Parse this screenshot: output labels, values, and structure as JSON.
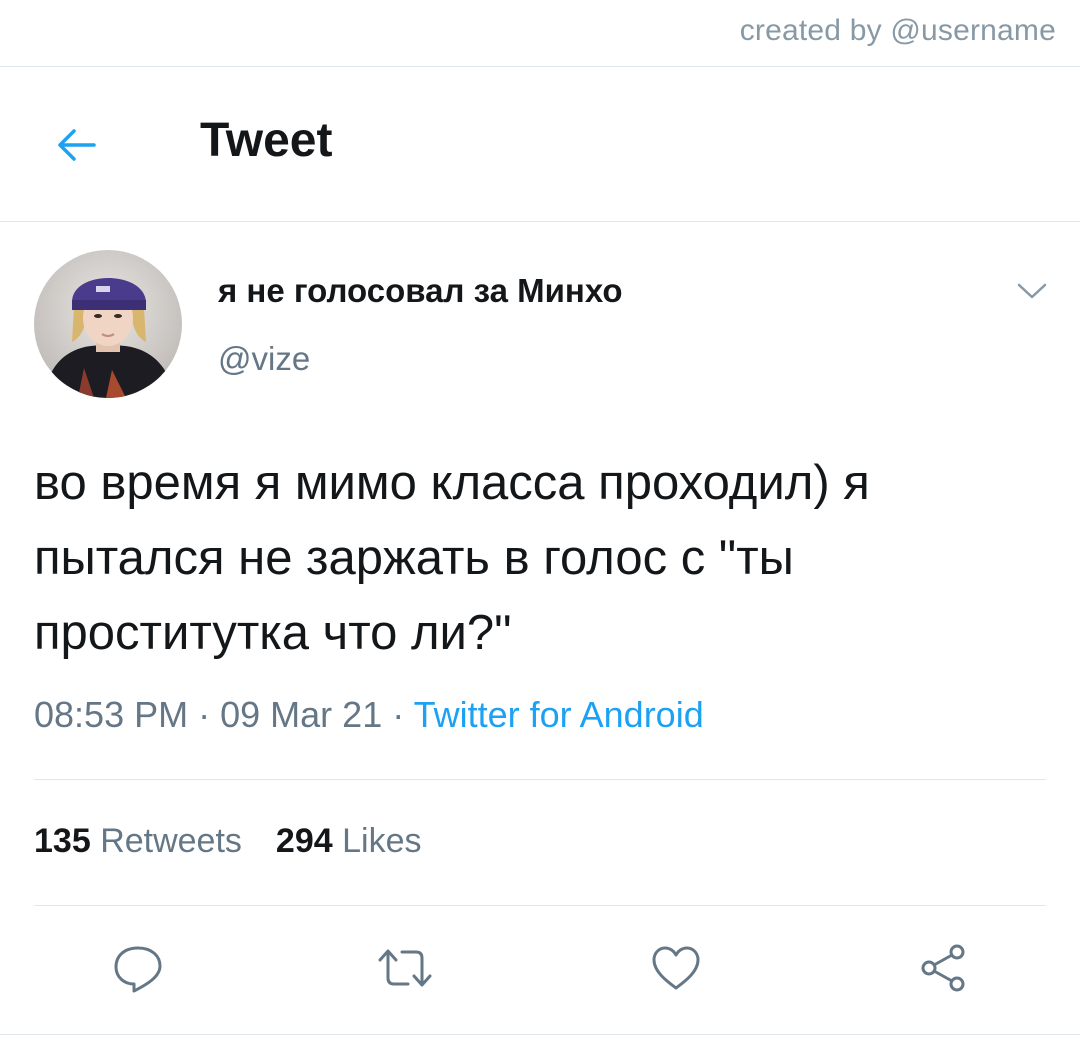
{
  "watermark": "created by @username",
  "header": {
    "title": "Tweet",
    "back_icon": "arrow-left-icon",
    "accent_color": "#1da1f2"
  },
  "tweet": {
    "author": {
      "display_name": "я не голосовал за Минхо",
      "handle": "@vize",
      "avatar_icon": "avatar-photo"
    },
    "text": "во время я мимо класса проходил) я пытался не заржать в голос с \"ты проститутка что ли?\"",
    "time": "08:53 PM",
    "date": "09 Mar 21",
    "separator": "·",
    "source": "Twitter for Android",
    "stats": {
      "retweets_count": "135",
      "retweets_label": "Retweets",
      "likes_count": "294",
      "likes_label": "Likes"
    }
  },
  "actions": [
    {
      "name": "reply",
      "icon": "speech-bubble-icon"
    },
    {
      "name": "retweet",
      "icon": "retweet-arrows-icon"
    },
    {
      "name": "like",
      "icon": "heart-icon"
    },
    {
      "name": "share",
      "icon": "share-nodes-icon"
    }
  ],
  "colors": {
    "text_primary": "#14171a",
    "text_secondary": "#657786",
    "link": "#1da1f2",
    "divider": "#e1e8ed"
  }
}
